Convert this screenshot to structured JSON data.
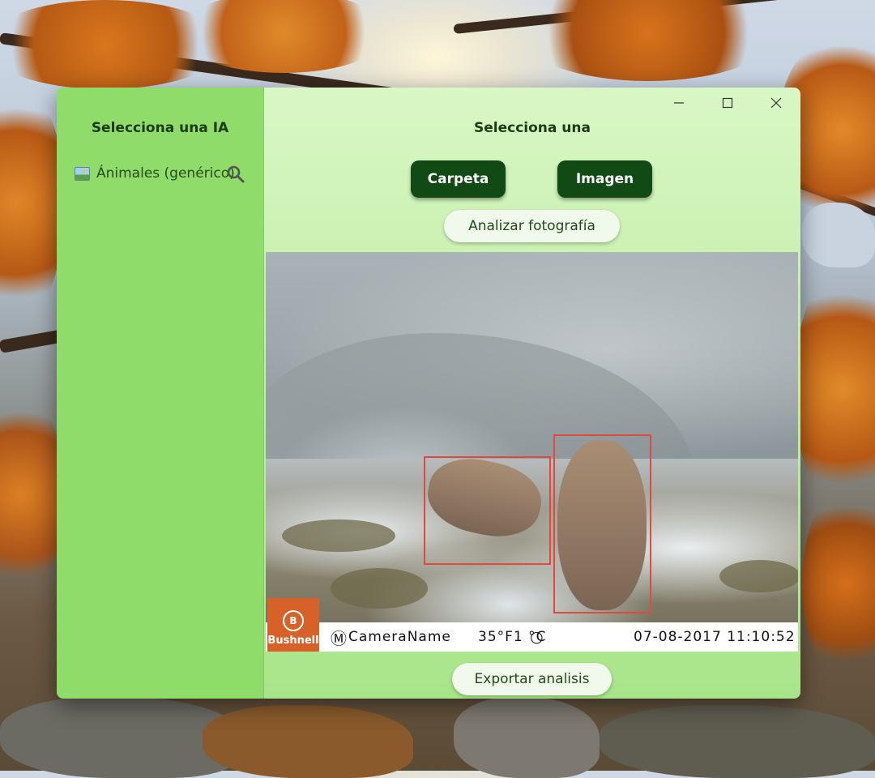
{
  "sidebar": {
    "title": "Selecciona una IA",
    "models": [
      {
        "label": "Ánimales (genérico)",
        "icon": "picture-icon"
      }
    ],
    "search_icon": "search-icon"
  },
  "main": {
    "title": "Selecciona una",
    "buttons": {
      "folder": "Carpeta",
      "image": "Imagen",
      "analyze": "Analizar fotografía",
      "export": "Exportar analisis"
    }
  },
  "window_controls": {
    "minimize": "minimize-icon",
    "maximize": "maximize-icon",
    "close": "close-icon"
  },
  "photo": {
    "brand": "Bushnell",
    "brand_letter": "B",
    "mode_symbol": "Ⓜ",
    "camera_name": "CameraName",
    "temperature": "35°F1 °C",
    "timestamp": "07-08-2017 11:10:52",
    "detections": 2
  },
  "colors": {
    "sidebar_bg": "#8fdc6a",
    "main_bg": "#c6f0ad",
    "dark_button": "#114a14",
    "bbox": "#e04a3e"
  }
}
